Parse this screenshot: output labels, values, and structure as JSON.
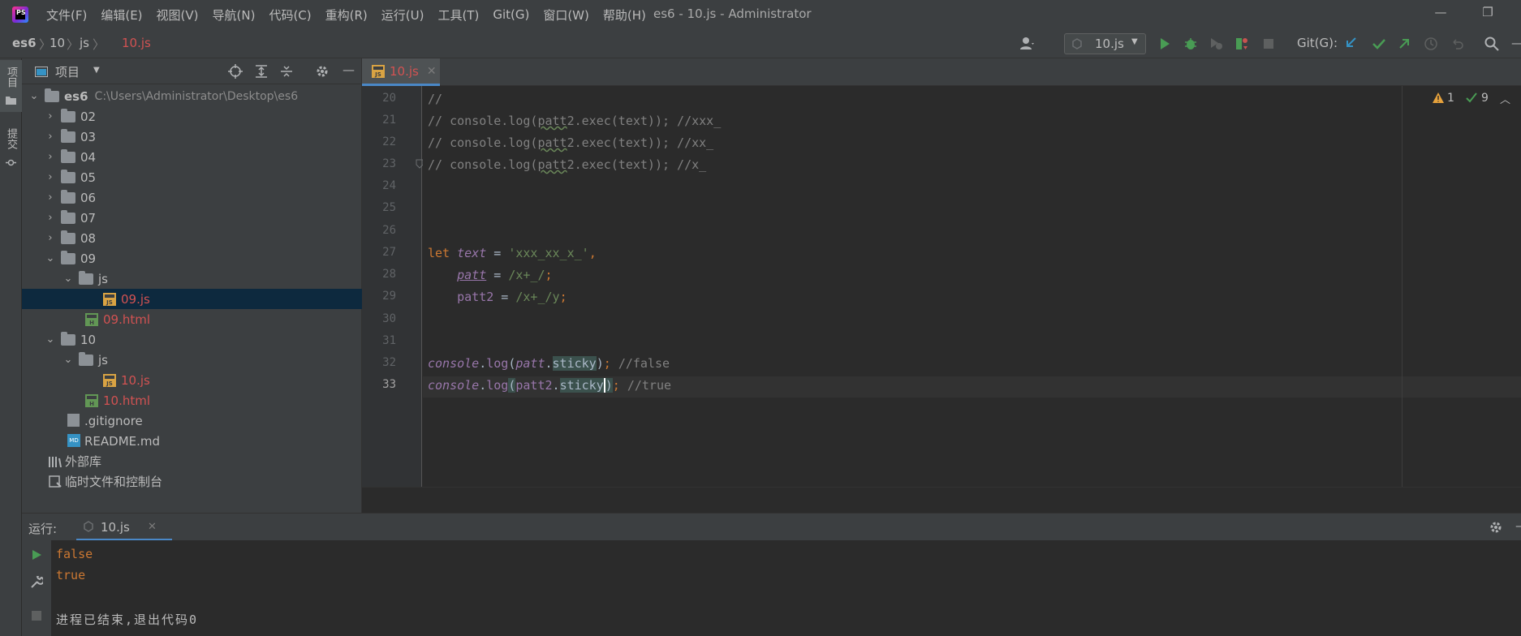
{
  "menubar": {
    "items": [
      "文件(F)",
      "编辑(E)",
      "视图(V)",
      "导航(N)",
      "代码(C)",
      "重构(R)",
      "运行(U)",
      "工具(T)",
      "Git(G)",
      "窗口(W)",
      "帮助(H)"
    ],
    "title": "es6 - 10.js - Administrator",
    "minimize": "—",
    "restore": "❐"
  },
  "breadcrumb": {
    "items": [
      "es6",
      "10",
      "js",
      "10.js"
    ]
  },
  "toolbar": {
    "run_config": "10.js",
    "git_label": "Git(G):"
  },
  "sidebar": {
    "project_label": "项目",
    "commit_label": "提交"
  },
  "project": {
    "title": "项目",
    "root_name": "es6",
    "root_path": "C:\\Users\\Administrator\\Desktop\\es6",
    "folders_collapsed": [
      "02",
      "03",
      "04",
      "05",
      "06",
      "07",
      "08"
    ],
    "folder_09": "09",
    "js_09": "js",
    "file_09js": "09.js",
    "file_09html": "09.html",
    "folder_10": "10",
    "js_10": "js",
    "file_10js": "10.js",
    "file_10html": "10.html",
    "gitignore": ".gitignore",
    "readme": "README.md",
    "external_libs": "外部库",
    "scratches": "临时文件和控制台"
  },
  "editor": {
    "tab_label": "10.js",
    "warnings": "1",
    "checks": "9",
    "lines": [
      "20",
      "21",
      "22",
      "23",
      "24",
      "25",
      "26",
      "27",
      "28",
      "29",
      "30",
      "31",
      "32",
      "33"
    ]
  },
  "run": {
    "label": "运行:",
    "tab": "10.js",
    "output": [
      "false",
      "true",
      "",
      "进程已结束,退出代码0"
    ]
  }
}
